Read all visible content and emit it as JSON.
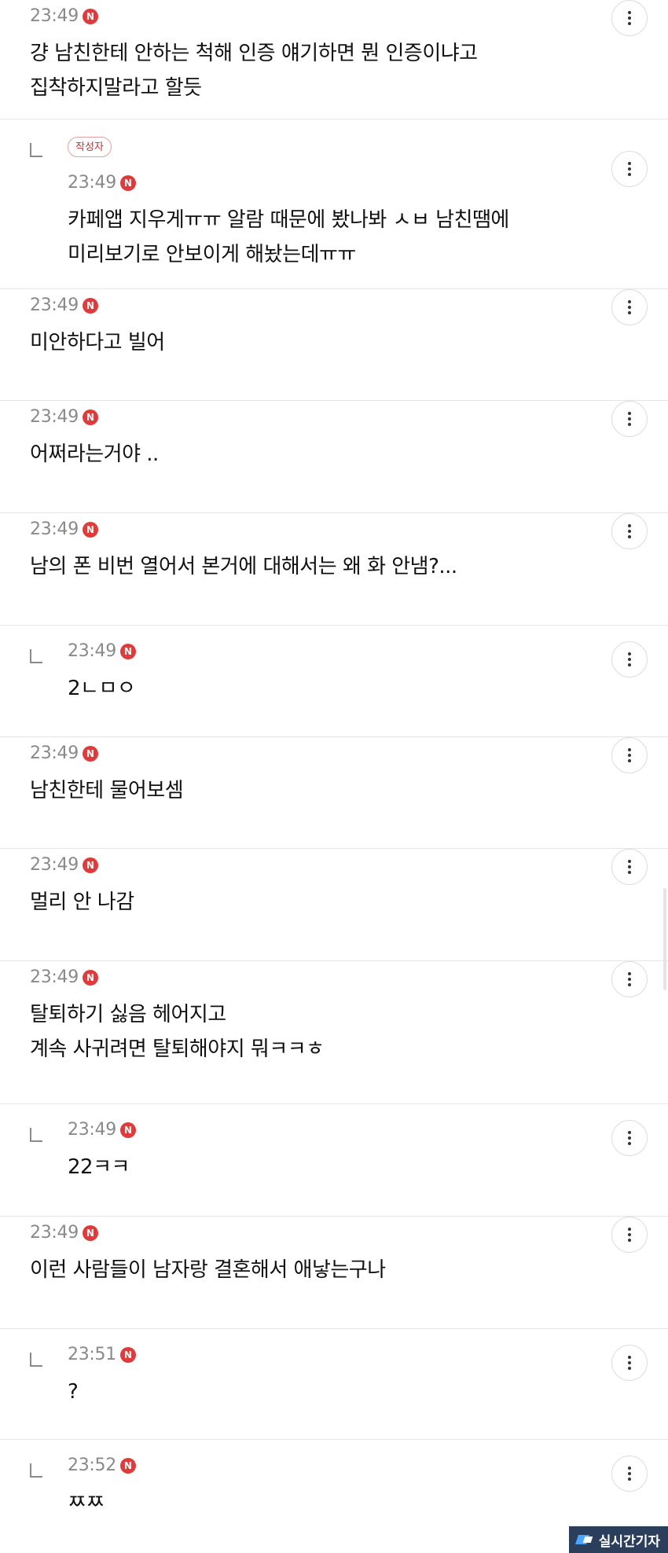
{
  "comments": [
    {
      "is_reply": false,
      "is_author": false,
      "time": "23:49",
      "new_badge": "N",
      "text": "걍 남친한테 안하는 척해 인증 얘기하면 뭔 인증이냐고\n집착하지말라고 할듯"
    },
    {
      "is_reply": true,
      "is_author": true,
      "author_label": "작성자",
      "time": "23:49",
      "new_badge": "N",
      "text": "카페앱 지우게ㅠㅠ 알람 때문에 봤나봐 ㅅㅂ 남친땜에\n미리보기로 안보이게 해놨는데ㅠㅠ"
    },
    {
      "is_reply": false,
      "is_author": false,
      "time": "23:49",
      "new_badge": "N",
      "text": "미안하다고 빌어"
    },
    {
      "is_reply": false,
      "is_author": false,
      "time": "23:49",
      "new_badge": "N",
      "text": "어쩌라는거야 .."
    },
    {
      "is_reply": false,
      "is_author": false,
      "time": "23:49",
      "new_badge": "N",
      "text": "남의 폰 비번 열어서 본거에 대해서는 왜 화 안냄?..."
    },
    {
      "is_reply": true,
      "is_author": false,
      "time": "23:49",
      "new_badge": "N",
      "text": "2ㄴㅁㅇ"
    },
    {
      "is_reply": false,
      "is_author": false,
      "time": "23:49",
      "new_badge": "N",
      "text": "남친한테 물어보셈"
    },
    {
      "is_reply": false,
      "is_author": false,
      "time": "23:49",
      "new_badge": "N",
      "text": "멀리 안 나감"
    },
    {
      "is_reply": false,
      "is_author": false,
      "time": "23:49",
      "new_badge": "N",
      "text": "탈퇴하기 싫음 헤어지고\n계속 사귀려면 탈퇴해야지 뭐ㅋㅋㅎ"
    },
    {
      "is_reply": true,
      "is_author": false,
      "time": "23:49",
      "new_badge": "N",
      "text": "22ㅋㅋ"
    },
    {
      "is_reply": false,
      "is_author": false,
      "time": "23:49",
      "new_badge": "N",
      "text": "이런 사람들이 남자랑 결혼해서 애낳는구나"
    },
    {
      "is_reply": true,
      "is_author": false,
      "time": "23:51",
      "new_badge": "N",
      "text": "?"
    },
    {
      "is_reply": true,
      "is_author": false,
      "time": "23:52",
      "new_badge": "N",
      "text": "ㅉㅉ"
    }
  ],
  "watermark": {
    "text": "실시간기자"
  },
  "colors": {
    "new_badge": "#e03a3a",
    "timestamp": "#8a8a8a",
    "author_badge": "#c03030",
    "watermark_bg": "#2b3f5c"
  }
}
